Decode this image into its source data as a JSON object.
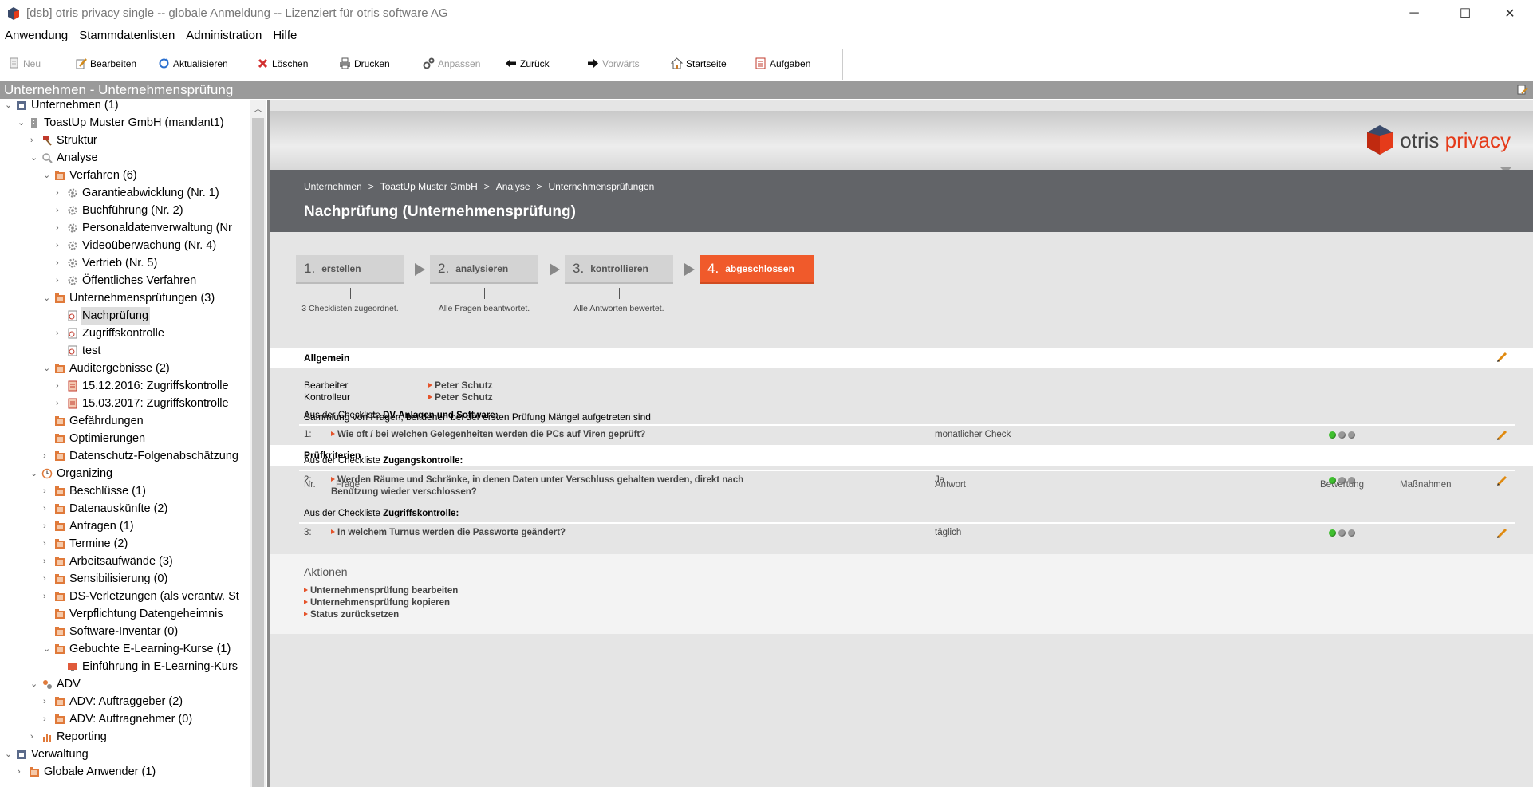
{
  "window": {
    "title": "[dsb] otris privacy single -- globale Anmeldung -- Lizenziert für otris software AG",
    "minimize": "─",
    "maximize": "☐",
    "close": "✕"
  },
  "menu": [
    "Anwendung",
    "Stammdatenlisten",
    "Administration",
    "Hilfe"
  ],
  "toolbar": {
    "neu": "Neu",
    "bearbeiten": "Bearbeiten",
    "aktualisieren": "Aktualisieren",
    "loeschen": "Löschen",
    "drucken": "Drucken",
    "anpassen": "Anpassen",
    "zurueck": "Zurück",
    "vorwaerts": "Vorwärts",
    "startseite": "Startseite",
    "aufgaben": "Aufgaben"
  },
  "panel": {
    "header": "Unternehmen - Unternehmensprüfung"
  },
  "tree": [
    {
      "label": "Unternehmen (1)",
      "expanded": "open",
      "icon": "company-icon"
    },
    {
      "label": "ToastUp Muster GmbH (mandant1)",
      "expanded": "open",
      "icon": "building-icon"
    },
    {
      "label": "Struktur",
      "expanded": "closed",
      "icon": "hammer-icon"
    },
    {
      "label": "Analyse",
      "expanded": "open",
      "icon": "magnifier-icon"
    },
    {
      "label": "Verfahren (6)",
      "expanded": "open",
      "icon": "folder-icon"
    },
    {
      "label": "Garantieabwicklung (Nr. 1)",
      "expanded": "closed",
      "icon": "gear-icon"
    },
    {
      "label": "Buchführung (Nr. 2)",
      "expanded": "closed",
      "icon": "gear-icon"
    },
    {
      "label": "Personaldatenverwaltung (Nr",
      "expanded": "closed",
      "icon": "gear-icon"
    },
    {
      "label": "Videoüberwachung (Nr. 4)",
      "expanded": "closed",
      "icon": "gear-icon"
    },
    {
      "label": "Vertrieb (Nr. 5)",
      "expanded": "closed",
      "icon": "gear-icon"
    },
    {
      "label": "Öffentliches Verfahren",
      "expanded": "closed",
      "icon": "gear-icon"
    },
    {
      "label": "Unternehmensprüfungen (3)",
      "expanded": "open",
      "icon": "folder-icon"
    },
    {
      "label": "Nachprüfung",
      "expanded": "none",
      "icon": "audit-icon"
    },
    {
      "label": "Zugriffskontrolle",
      "expanded": "closed",
      "icon": "audit-icon"
    },
    {
      "label": "test",
      "expanded": "none",
      "icon": "audit-icon"
    },
    {
      "label": "Auditergebnisse (2)",
      "expanded": "open",
      "icon": "folder-icon"
    },
    {
      "label": "15.12.2016: Zugriffskontrolle",
      "expanded": "closed",
      "icon": "result-icon"
    },
    {
      "label": "15.03.2017: Zugriffskontrolle",
      "expanded": "closed",
      "icon": "result-icon"
    },
    {
      "label": "Gefährdungen",
      "expanded": "none",
      "icon": "folder-icon"
    },
    {
      "label": "Optimierungen",
      "expanded": "none",
      "icon": "folder-icon"
    },
    {
      "label": "Datenschutz-Folgenabschätzung",
      "expanded": "closed",
      "icon": "folder-icon"
    },
    {
      "label": "Organizing",
      "expanded": "open",
      "icon": "clock-icon"
    },
    {
      "label": "Beschlüsse (1)",
      "expanded": "closed",
      "icon": "folder-icon"
    },
    {
      "label": "Datenauskünfte (2)",
      "expanded": "closed",
      "icon": "folder-icon"
    },
    {
      "label": "Anfragen (1)",
      "expanded": "closed",
      "icon": "folder-icon"
    },
    {
      "label": "Termine (2)",
      "expanded": "closed",
      "icon": "folder-icon"
    },
    {
      "label": "Arbeitsaufwände (3)",
      "expanded": "closed",
      "icon": "folder-icon"
    },
    {
      "label": "Sensibilisierung (0)",
      "expanded": "closed",
      "icon": "folder-icon"
    },
    {
      "label": "DS-Verletzungen (als verantw. St",
      "expanded": "closed",
      "icon": "folder-icon"
    },
    {
      "label": "Verpflichtung Datengeheimnis",
      "expanded": "none",
      "icon": "folder-icon"
    },
    {
      "label": "Software-Inventar (0)",
      "expanded": "none",
      "icon": "folder-icon"
    },
    {
      "label": "Gebuchte E-Learning-Kurse (1)",
      "expanded": "open",
      "icon": "folder-icon"
    },
    {
      "label": "Einführung in E-Learning-Kurs",
      "expanded": "none",
      "icon": "course-icon"
    },
    {
      "label": "ADV",
      "expanded": "open",
      "icon": "adv-icon"
    },
    {
      "label": "ADV: Auftraggeber (2)",
      "expanded": "closed",
      "icon": "folder-icon"
    },
    {
      "label": "ADV: Auftragnehmer (0)",
      "expanded": "closed",
      "icon": "folder-icon"
    },
    {
      "label": "Reporting",
      "expanded": "closed",
      "icon": "chart-icon"
    },
    {
      "label": "Verwaltung",
      "expanded": "open",
      "icon": "company-icon"
    },
    {
      "label": "Globale Anwender (1)",
      "expanded": "closed",
      "icon": "folder-icon"
    }
  ],
  "brand": {
    "otris": "otris",
    "privacy": "privacy"
  },
  "breadcrumb": [
    "Unternehmen",
    ">",
    "ToastUp Muster GmbH",
    ">",
    "Analyse",
    ">",
    "Unternehmensprüfungen"
  ],
  "page_title": "Nachprüfung (Unternehmensprüfung)",
  "steps": [
    {
      "num": "1.",
      "label": "erstellen",
      "note": "3 Checklisten zugeordnet."
    },
    {
      "num": "2.",
      "label": "analysieren",
      "note": "Alle Fragen beantwortet."
    },
    {
      "num": "3.",
      "label": "kontrollieren",
      "note": "Alle Antworten bewertet."
    },
    {
      "num": "4.",
      "label": "abgeschlossen"
    }
  ],
  "allgemein": {
    "title": "Allgemein",
    "bearbeiter_label": "Bearbeiter",
    "bearbeiter": "Peter Schutz",
    "kontrolleur_label": "Kontrolleur",
    "kontrolleur": "Peter Schutz",
    "description": "Sammlung von Fragen, bei denen bei der ersten Prüfung Mängel aufgetreten sind"
  },
  "pruefkriterien": {
    "title": "Prüfkriterien",
    "columns": {
      "nr": "Nr.",
      "frage": "Frage",
      "antwort": "Antwort",
      "bewertung": "Bewertung",
      "massnahmen": "Maßnahmen"
    },
    "groups": [
      {
        "prefix": "Aus der Checkliste",
        "name": "DV-Anlagen und Software:",
        "nr": "1:",
        "frage": "Wie oft / bei welchen Gelegenheiten werden die PCs auf Viren geprüft?",
        "antwort": "monatlicher Check",
        "rating": 1
      },
      {
        "prefix": "Aus der Checkliste",
        "name": "Zugangskontrolle:",
        "nr": "2:",
        "frage": "Werden Räume und Schränke, in denen Daten unter Verschluss gehalten werden, direkt nach Benutzung wieder verschlossen?",
        "antwort": "Ja",
        "rating": 1
      },
      {
        "prefix": "Aus der Checkliste",
        "name": "Zugriffskontrolle:",
        "nr": "3:",
        "frage": "In welchem Turnus werden die Passworte geändert?",
        "antwort": "täglich",
        "rating": 1
      }
    ]
  },
  "aktionen": {
    "title": "Aktionen",
    "items": [
      "Unternehmensprüfung bearbeiten",
      "Unternehmensprüfung kopieren",
      "Status zurücksetzen"
    ]
  },
  "colors": {
    "accent": "#f05a2b",
    "dark_bar": "#626468",
    "panel_header": "#9a9a9a",
    "rating_green": "#3fbf2f"
  }
}
